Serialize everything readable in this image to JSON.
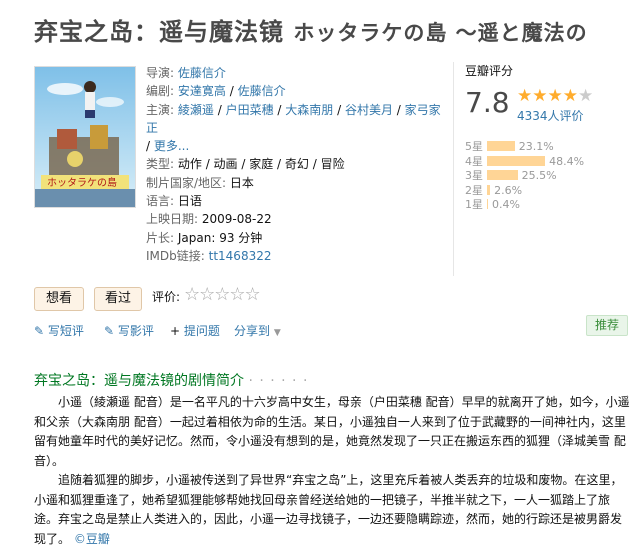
{
  "title": {
    "main": "弃宝之岛：遥与魔法镜",
    "original": "ホッタラケの島 ～遥と魔法の"
  },
  "info": [
    {
      "label": "导演:",
      "parts": [
        "佐藤信介"
      ]
    },
    {
      "label": "编剧:",
      "parts": [
        "安達寛高",
        "佐藤信介"
      ]
    },
    {
      "label": "主演:",
      "parts": [
        "綾瀬遥",
        "户田菜穗",
        "大森南朋",
        "谷村美月",
        "家弓家正",
        "更多..."
      ]
    },
    {
      "label": "类型:",
      "value": "动作 / 动画 / 家庭 / 奇幻 / 冒险"
    },
    {
      "label": "制片国家/地区:",
      "value": "日本"
    },
    {
      "label": "语言:",
      "value": "日语"
    },
    {
      "label": "上映日期:",
      "value": "2009-08-22"
    },
    {
      "label": "片长:",
      "value": "Japan: 93 分钟"
    },
    {
      "label": "IMDb链接:",
      "link": "tt1468322"
    }
  ],
  "rating": {
    "header": "豆瓣评分",
    "score": "7.8",
    "stars_on": 4,
    "votes": "4334人评价",
    "dist": [
      {
        "label": "5星",
        "pct": "23.1%",
        "value": 23.1
      },
      {
        "label": "4星",
        "pct": "48.4%",
        "value": 48.4
      },
      {
        "label": "3星",
        "pct": "25.5%",
        "value": 25.5
      },
      {
        "label": "2星",
        "pct": "2.6%",
        "value": 2.6
      },
      {
        "label": "1星",
        "pct": "0.4%",
        "value": 0.4
      }
    ]
  },
  "buttons": {
    "want": "想看",
    "seen": "看过",
    "rate_label": "评价:",
    "rate_stars": "☆☆☆☆☆"
  },
  "actions": {
    "short": "写短评",
    "review": "写影评",
    "ask": "提问题",
    "share": "分享到",
    "recommend": "推荐"
  },
  "synopsis": {
    "heading": "弃宝之岛：遥与魔法镜的剧情简介",
    "dots": "· · · · · ·",
    "p1": "小遥（綾瀬遥 配音）是一名平凡的十六岁高中女生，母亲（户田菜穗 配音）早早的就离开了她，如今，小遥和父亲（大森南朋 配音）一起过着相依为命的生活。某日，小遥独自一人来到了位于武藏野的一间神社内，这里留有她童年时代的美好记忆。然而，令小遥没有想到的是，她竟然发现了一只正在搬运东西的狐狸（泽城美雪 配音）。",
    "p2": "追随着狐狸的脚步，小遥被传送到了异世界“弃宝之岛”上，这里充斥着被人类丢弃的垃圾和废物。在这里，小遥和狐狸重逢了，她希望狐狸能够帮她找回母亲曾经送给她的一把镜子，半推半就之下，一人一狐踏上了旅途。弃宝之岛是禁止人类进入的，因此，小遥一边寻找镜子，一边还要隐瞒踪迹，然而，她的行踪还是被男爵发现了。",
    "credit": "©豆瓣"
  },
  "colors": {
    "link": "#3377aa",
    "heading": "#007722",
    "bar": "#ffd596",
    "star": "#ffac2d"
  }
}
